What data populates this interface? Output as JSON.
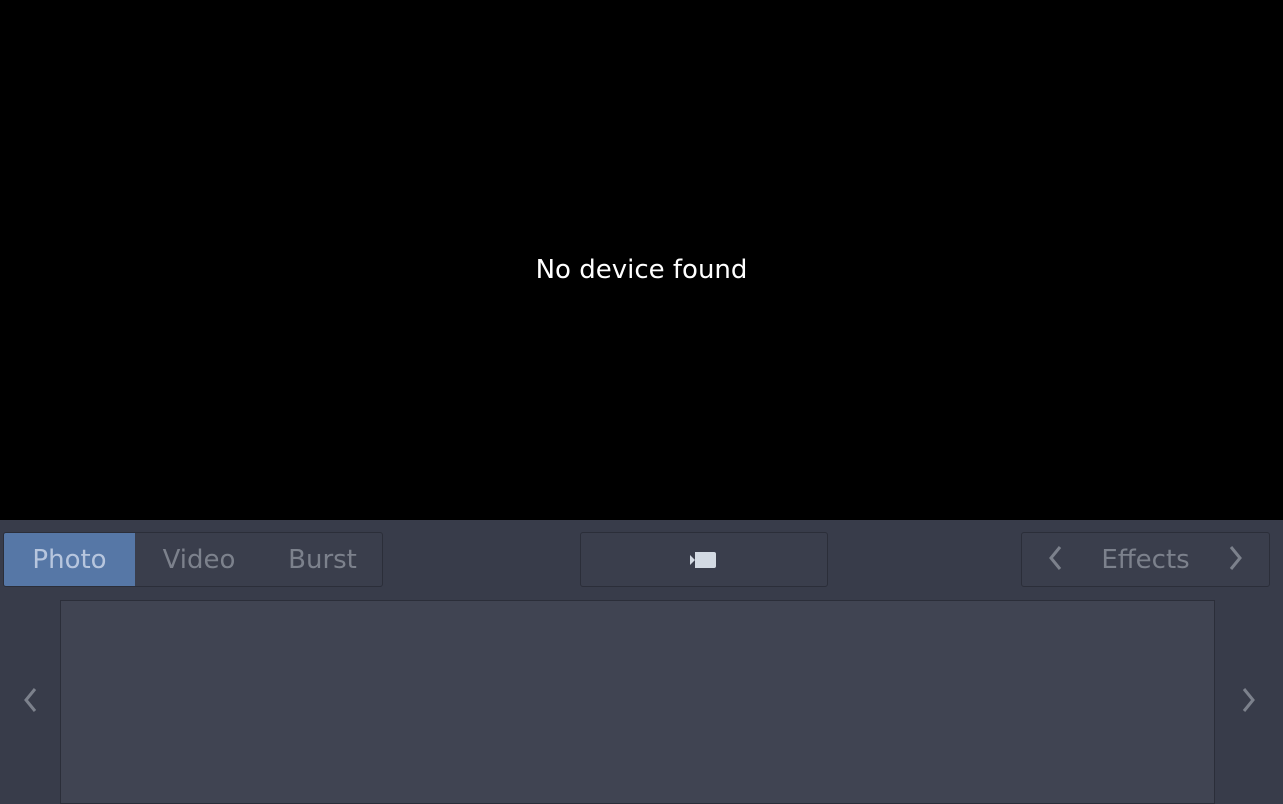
{
  "viewport": {
    "message": "No device found"
  },
  "modes": {
    "items": [
      {
        "label": "Photo",
        "active": true
      },
      {
        "label": "Video",
        "active": false
      },
      {
        "label": "Burst",
        "active": false
      }
    ]
  },
  "capture": {
    "icon": "camera-icon"
  },
  "effects": {
    "label": "Effects",
    "prev_icon": "chevron-left-icon",
    "next_icon": "chevron-right-icon"
  },
  "strip": {
    "prev_icon": "chevron-left-icon",
    "next_icon": "chevron-right-icon"
  },
  "colors": {
    "viewport_bg": "#000000",
    "panel_bg": "#383c4a",
    "active_mode": "#5677a6",
    "inactive_text": "#7c818c"
  }
}
